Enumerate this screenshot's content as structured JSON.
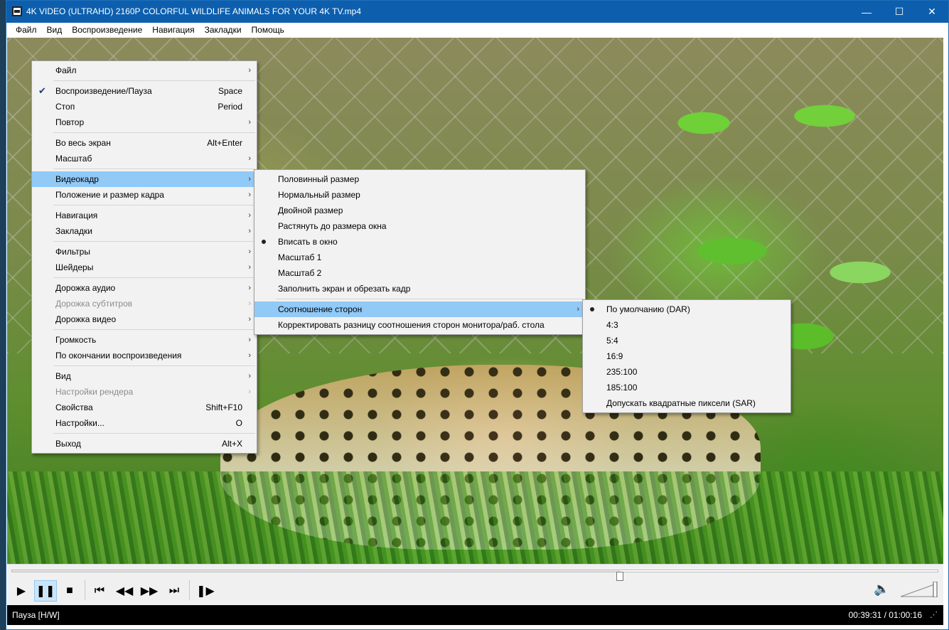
{
  "window": {
    "title": "4K VIDEO (ULTRAHD) 2160P COLORFUL WILDLIFE ANIMALS FOR YOUR 4K TV.mp4",
    "minimize": "—",
    "maximize": "☐",
    "close": "✕"
  },
  "menubar": [
    "Файл",
    "Вид",
    "Воспроизведение",
    "Навигация",
    "Закладки",
    "Помощь"
  ],
  "main_menu": {
    "items": [
      {
        "label": "Файл",
        "shortcut": "",
        "submenu": true
      },
      {
        "label": "Воспроизведение/Пауза",
        "shortcut": "Space",
        "checked": true
      },
      {
        "label": "Стоп",
        "shortcut": "Period"
      },
      {
        "label": "Повтор",
        "shortcut": "",
        "submenu": true
      },
      {
        "label": "Во весь экран",
        "shortcut": "Alt+Enter"
      },
      {
        "label": "Масштаб",
        "shortcut": "",
        "submenu": true
      },
      {
        "label": "Видеокадр",
        "shortcut": "",
        "submenu": true,
        "highlighted": true
      },
      {
        "label": "Положение и размер кадра",
        "shortcut": "",
        "submenu": true
      },
      {
        "label": "Навигация",
        "shortcut": "",
        "submenu": true
      },
      {
        "label": "Закладки",
        "shortcut": "",
        "submenu": true
      },
      {
        "label": "Фильтры",
        "shortcut": "",
        "submenu": true
      },
      {
        "label": "Шейдеры",
        "shortcut": "",
        "submenu": true
      },
      {
        "label": "Дорожка аудио",
        "shortcut": "",
        "submenu": true
      },
      {
        "label": "Дорожка субтитров",
        "shortcut": "",
        "submenu": true,
        "disabled": true
      },
      {
        "label": "Дорожка видео",
        "shortcut": "",
        "submenu": true
      },
      {
        "label": "Громкость",
        "shortcut": "",
        "submenu": true
      },
      {
        "label": "По окончании воспроизведения",
        "shortcut": "",
        "submenu": true
      },
      {
        "label": "Вид",
        "shortcut": "",
        "submenu": true
      },
      {
        "label": "Настройки рендера",
        "shortcut": "",
        "submenu": true,
        "disabled": true
      },
      {
        "label": "Свойства",
        "shortcut": "Shift+F10"
      },
      {
        "label": "Настройки...",
        "shortcut": "O"
      },
      {
        "label": "Выход",
        "shortcut": "Alt+X"
      }
    ]
  },
  "video_frame_menu": {
    "items": [
      {
        "label": "Половинный размер"
      },
      {
        "label": "Нормальный размер"
      },
      {
        "label": "Двойной размер"
      },
      {
        "label": "Растянуть до размера окна"
      },
      {
        "label": "Вписать в окно",
        "selected": true
      },
      {
        "label": "Масштаб 1"
      },
      {
        "label": "Масштаб 2"
      },
      {
        "label": "Заполнить экран и обрезать кадр"
      },
      {
        "label": "Соотношение сторон",
        "submenu": true,
        "highlighted": true
      },
      {
        "label": "Корректировать разницу соотношения сторон монитора/раб. стола"
      }
    ]
  },
  "aspect_menu": {
    "items": [
      {
        "label": "По умолчанию (DAR)",
        "selected": true
      },
      {
        "label": "4:3"
      },
      {
        "label": "5:4"
      },
      {
        "label": "16:9"
      },
      {
        "label": "235:100"
      },
      {
        "label": "185:100"
      },
      {
        "label": "Допускать квадратные пиксели (SAR)"
      }
    ]
  },
  "icons": {
    "submenu_arrow": "›",
    "check": "✔",
    "play": "▶",
    "pause": "❚❚",
    "stop": "■",
    "prev": "⏮",
    "rewind": "◀◀",
    "forward": "▶▶",
    "next": "⏭",
    "frame_step": "❚▶",
    "volume": "🔈",
    "resize_grip": "⋰"
  },
  "playback": {
    "progress": 0.657,
    "volume": 1.0
  },
  "status": {
    "left": "Пауза [H/W]",
    "time": "00:39:31 / 01:00:16"
  },
  "colors": {
    "titlebar": "#0d5fae",
    "menu_highlight": "#91c9f7",
    "statusbar": "#000000"
  }
}
